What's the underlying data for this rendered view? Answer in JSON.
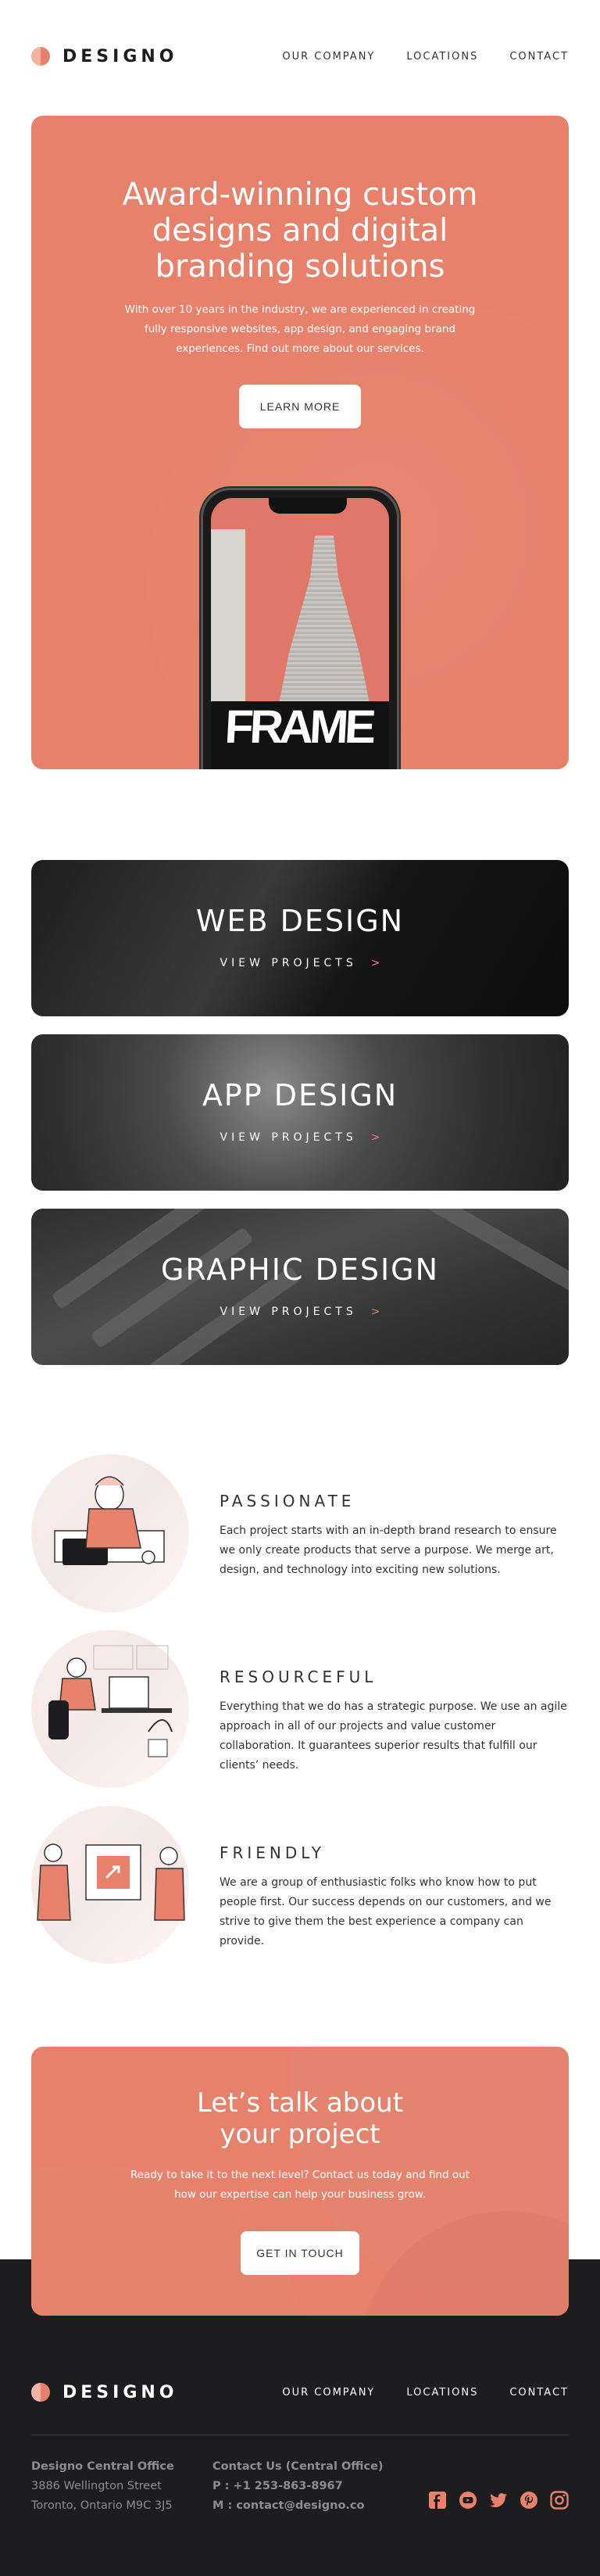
{
  "brand": {
    "name": "DESIGNO"
  },
  "nav": {
    "company": "OUR COMPANY",
    "locations": "LOCATIONS",
    "contact": "CONTACT"
  },
  "hero": {
    "title": "Award-winning custom designs and digital branding solutions",
    "text": "With over 10 years in the industry, we are experienced in creating fully responsive websites, app design, and engaging brand experiences. Find out more about our services.",
    "button": "LEARN MORE",
    "phone_text": "FRAME"
  },
  "categories": [
    {
      "title": "WEB DESIGN",
      "link": "VIEW PROJECTS",
      "chevron": ">"
    },
    {
      "title": "APP DESIGN",
      "link": "VIEW PROJECTS",
      "chevron": ">"
    },
    {
      "title": "GRAPHIC DESIGN",
      "link": "VIEW PROJECTS",
      "chevron": ">"
    }
  ],
  "features": [
    {
      "title": "PASSIONATE",
      "text": "Each project starts with an in-depth brand research to ensure we only create products that serve a purpose. We merge art, design, and technology into exciting new solutions."
    },
    {
      "title": "RESOURCEFUL",
      "text": "Everything that we do has a strategic purpose. We use an agile approach in all of our projects and value customer collaboration. It guarantees superior results that fulfill our clients’ needs."
    },
    {
      "title": "FRIENDLY",
      "text": "We are a group of enthusiastic folks who know how to put people first. Our success depends on our customers, and we strive to give them the best experience a company can provide."
    }
  ],
  "cta": {
    "title_line1": "Let’s talk about",
    "title_line2": "your project",
    "text": "Ready to take it to the next level? Contact us today and find out how our expertise can help your business grow.",
    "button": "GET IN TOUCH"
  },
  "footer": {
    "office_name": "Designo Central Office",
    "street": "3886 Wellington Street",
    "city": "Toronto, Ontario M9C 3J5",
    "contact_title": "Contact Us (Central Office)",
    "phone": "P : +1 253-863-8967",
    "email": "M : contact@designo.co"
  },
  "socials": [
    "facebook-icon",
    "youtube-icon",
    "twitter-icon",
    "pinterest-icon",
    "instagram-icon"
  ],
  "colors": {
    "accent": "#e7816b",
    "dark": "#1d1c1e",
    "text": "#333136",
    "muted": "#8e8c8f"
  }
}
